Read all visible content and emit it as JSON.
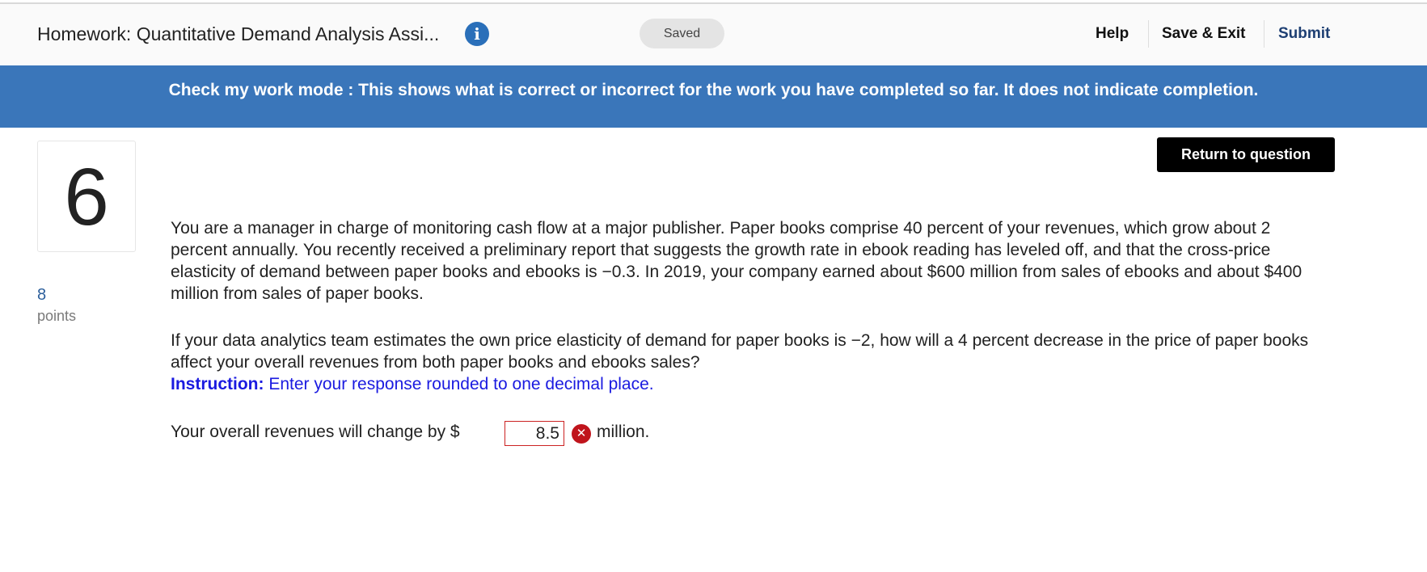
{
  "header": {
    "title": "Homework: Quantitative Demand Analysis Assi...",
    "info_icon": "info-icon",
    "save_status": "Saved",
    "help_label": "Help",
    "save_exit_label": "Save & Exit",
    "submit_label": "Submit"
  },
  "banner": {
    "text": "Check my work mode : This shows what is correct or incorrect for the work you have completed so far. It does not indicate completion."
  },
  "question": {
    "number": "6",
    "points_value": "8",
    "points_label": "points",
    "return_label": "Return to question",
    "paragraph1": "You are a manager in charge of monitoring cash flow at a major publisher. Paper books comprise 40 percent of your revenues, which grow about 2 percent annually. You recently received a preliminary report that suggests the growth rate in ebook reading has leveled off, and that the cross-price elasticity of demand between paper books and ebooks is −0.3. In 2019, your company earned about $600 million from sales of ebooks and about $400 million from sales of paper books.",
    "paragraph2": "If your data analytics team estimates the own price elasticity of demand for paper books is −2, how will a 4 percent decrease in the price of paper books affect your overall revenues from both paper books and ebooks sales?",
    "instruction_label": "Instruction:",
    "instruction_text": " Enter your response rounded to one decimal place.",
    "answer_prefix": "Your overall revenues will change by $",
    "answer_value": "8.5",
    "answer_unit": "million.",
    "answer_status_icon": "incorrect-icon"
  },
  "colors": {
    "banner": "#3a76ba",
    "info_icon": "#2a6fb9",
    "submit": "#1e3f73",
    "instruction": "#1a1ae0",
    "incorrect": "#c0141c"
  }
}
